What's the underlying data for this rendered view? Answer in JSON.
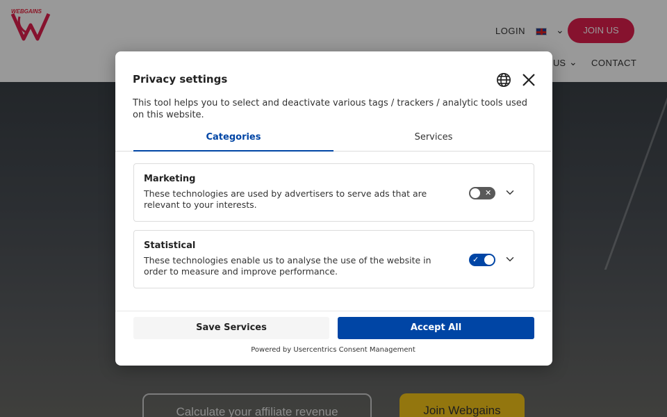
{
  "site": {
    "logo_text": "WEBGAINS",
    "login": "LOGIN",
    "join_us": "JOIN US",
    "nav_about_suffix": "US",
    "nav_contact": "CONTACT",
    "calc_button": "Calculate your affiliate revenue",
    "join_webgains": "Join Webgains"
  },
  "modal": {
    "title": "Privacy settings",
    "description": "This tool helps you to select and deactivate various tags / trackers / analytic tools used on this website.",
    "tabs": [
      {
        "label": "Categories",
        "active": true
      },
      {
        "label": "Services",
        "active": false
      }
    ],
    "categories": [
      {
        "title": "Marketing",
        "description": "These technologies are used by advertisers to serve ads that are relevant to your interests.",
        "enabled": false
      },
      {
        "title": "Statistical",
        "description": "These technologies enable us to analyse the use of the website in order to measure and improve performance.",
        "enabled": true
      }
    ],
    "save_button": "Save Services",
    "accept_button": "Accept All",
    "powered_by": "Powered by Usercentrics Consent Management"
  },
  "colors": {
    "accent": "#0045a5",
    "brand_red": "#e01f4d",
    "join_yellow": "#f5c518"
  },
  "icons": [
    "globe-icon",
    "close-icon",
    "chevron-down-icon",
    "check-icon",
    "x-icon",
    "flag-uk-icon"
  ]
}
